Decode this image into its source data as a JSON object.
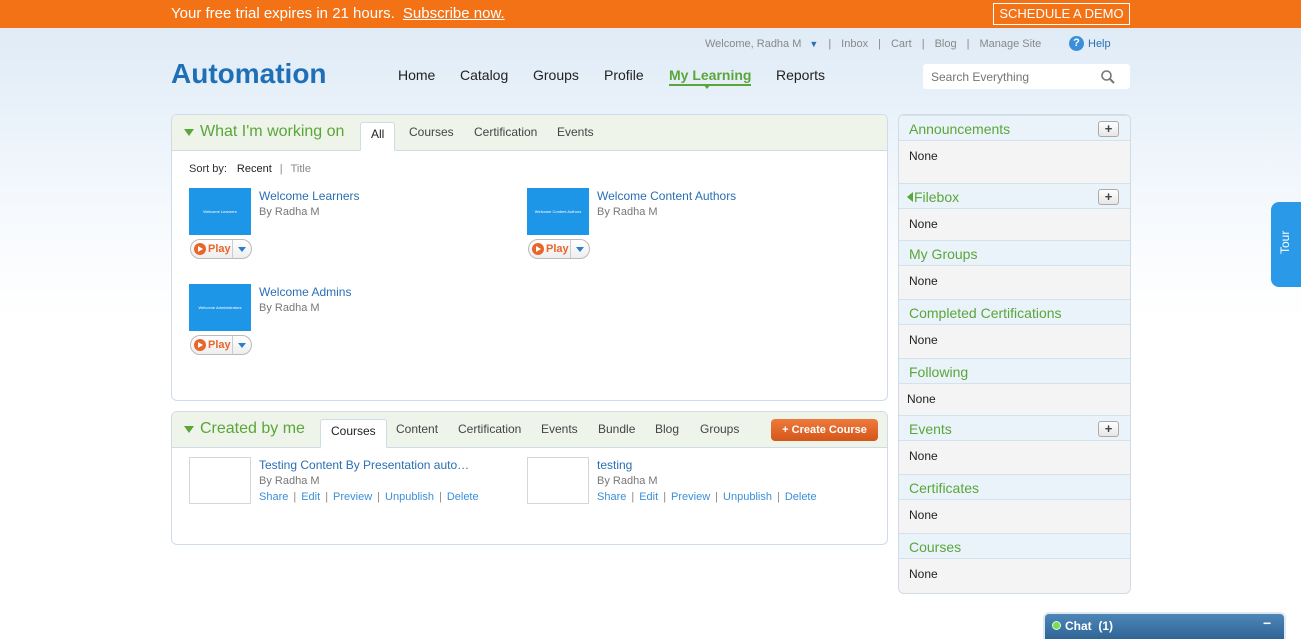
{
  "trial": {
    "message": "Your free trial expires in 21 hours.",
    "subscribe": "Subscribe now.",
    "demo": "SCHEDULE A DEMO"
  },
  "utility": {
    "welcome": "Welcome, Radha M",
    "links": [
      "Inbox",
      "Cart",
      "Blog",
      "Manage Site"
    ],
    "help": "Help"
  },
  "brand": {
    "logo": "Automation"
  },
  "nav": {
    "items": [
      "Home",
      "Catalog",
      "Groups",
      "Profile",
      "My Learning",
      "Reports"
    ],
    "active": "My Learning"
  },
  "search": {
    "placeholder": "Search Everything"
  },
  "working_on": {
    "title": "What I'm working on",
    "tabs": [
      "All",
      "Courses",
      "Certification",
      "Events"
    ],
    "active_tab": "All",
    "sort": {
      "label": "Sort by:",
      "options": [
        "Recent",
        "Title"
      ],
      "sep": "|"
    },
    "items": [
      {
        "title": "Welcome Learners",
        "by": "By Radha M",
        "thumb_text": "Welcome Learners",
        "play": "Play"
      },
      {
        "title": "Welcome Content Authors",
        "by": "By Radha M",
        "thumb_text": "Welcome Content Authors",
        "play": "Play"
      },
      {
        "title": "Welcome Admins",
        "by": "By Radha M",
        "thumb_text": "Welcome Administrators",
        "play": "Play"
      }
    ]
  },
  "created_by_me": {
    "title": "Created by me",
    "tabs": [
      "Courses",
      "Content",
      "Certification",
      "Events",
      "Bundle",
      "Blog",
      "Groups"
    ],
    "active_tab": "Courses",
    "create_button": "+ Create Course",
    "actions": [
      "Share",
      "Edit",
      "Preview",
      "Unpublish",
      "Delete"
    ],
    "items": [
      {
        "title": "Testing Content By Presentation auto…",
        "by": "By Radha M"
      },
      {
        "title": "testing",
        "by": "By Radha M"
      }
    ]
  },
  "sidebar": {
    "sections": [
      {
        "title": "Announcements",
        "body": "None",
        "plus": "+"
      },
      {
        "title": "Filebox",
        "body": "None",
        "plus": "+"
      },
      {
        "title": "My Groups",
        "body": "None"
      },
      {
        "title": "Completed Certifications",
        "body": "None"
      },
      {
        "title": "Following",
        "body": "None"
      },
      {
        "title": "Events",
        "body": "None",
        "plus": "+"
      },
      {
        "title": "Certificates",
        "body": "None"
      },
      {
        "title": "Courses",
        "body": "None"
      }
    ]
  },
  "tour": {
    "label": "Tour"
  },
  "chat": {
    "label": "Chat",
    "count": "(1)",
    "minimize": "−"
  },
  "colors": {
    "trial_orange": "#f47216",
    "brand_blue": "#1f6fb7",
    "accent_green": "#5aa63a",
    "link_blue": "#2a6fb4",
    "tour_blue": "#2a9ae8"
  }
}
